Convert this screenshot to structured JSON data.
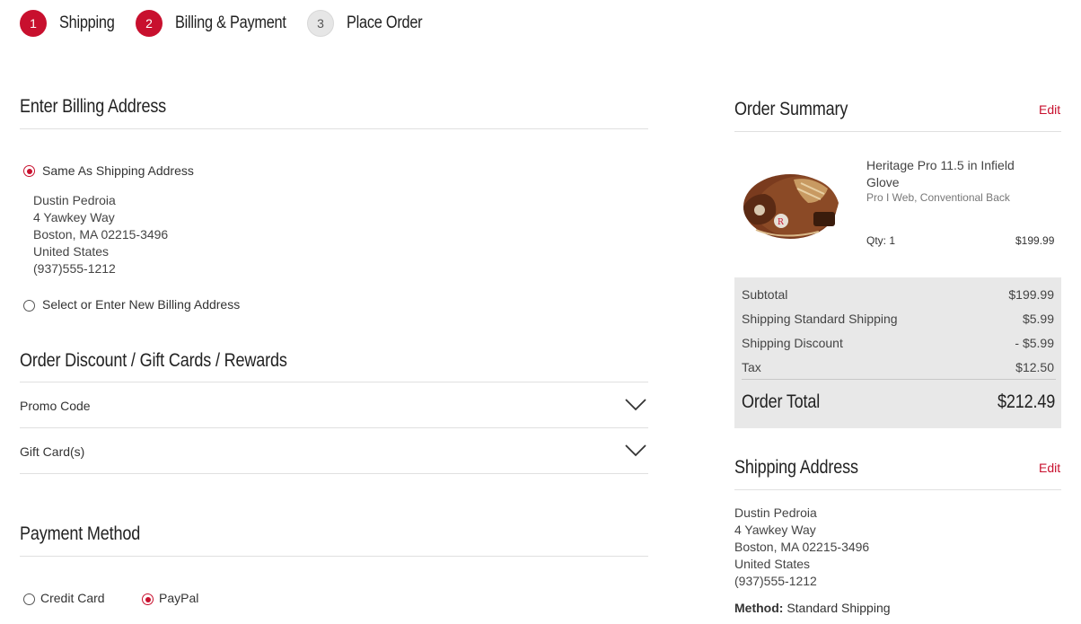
{
  "steps": [
    {
      "num": "1",
      "label": "Shipping"
    },
    {
      "num": "2",
      "label": "Billing & Payment"
    },
    {
      "num": "3",
      "label": "Place Order"
    }
  ],
  "billing": {
    "heading": "Enter Billing Address",
    "same_label": "Same As Shipping Address",
    "address": [
      "Dustin Pedroia",
      "4 Yawkey Way",
      "Boston, MA 02215-3496",
      "United States",
      "(937)555-1212"
    ],
    "new_label": "Select or Enter New Billing Address"
  },
  "discount": {
    "heading": "Order Discount / Gift Cards / Rewards",
    "promo_label": "Promo Code",
    "gift_label": "Gift Card(s)"
  },
  "payment": {
    "heading": "Payment Method",
    "credit_label": "Credit Card",
    "paypal_label": "PayPal",
    "selected": "PayPal"
  },
  "summary": {
    "heading": "Order Summary",
    "edit_label": "Edit",
    "product_name": "Heritage Pro 11.5 in Infield Glove",
    "product_options": "Pro I Web, Conventional Back",
    "qty": "Qty: 1",
    "price": "$199.99",
    "rows": [
      {
        "label": "Subtotal",
        "value": "$199.99"
      },
      {
        "label": "Shipping Standard Shipping",
        "value": "$5.99"
      },
      {
        "label": "Shipping Discount",
        "value": "- $5.99"
      },
      {
        "label": "Tax",
        "value": "$12.50"
      }
    ],
    "total_label": "Order Total",
    "total_value": "$212.49"
  },
  "shipping": {
    "heading": "Shipping Address",
    "edit_label": "Edit",
    "address": [
      "Dustin Pedroia",
      "4 Yawkey Way",
      "Boston, MA 02215-3496",
      "United States",
      "(937)555-1212"
    ],
    "method_label": "Method:",
    "method_value": "Standard Shipping"
  },
  "colors": {
    "accent": "#c8102e",
    "summary_bg": "#e8e8e8"
  }
}
